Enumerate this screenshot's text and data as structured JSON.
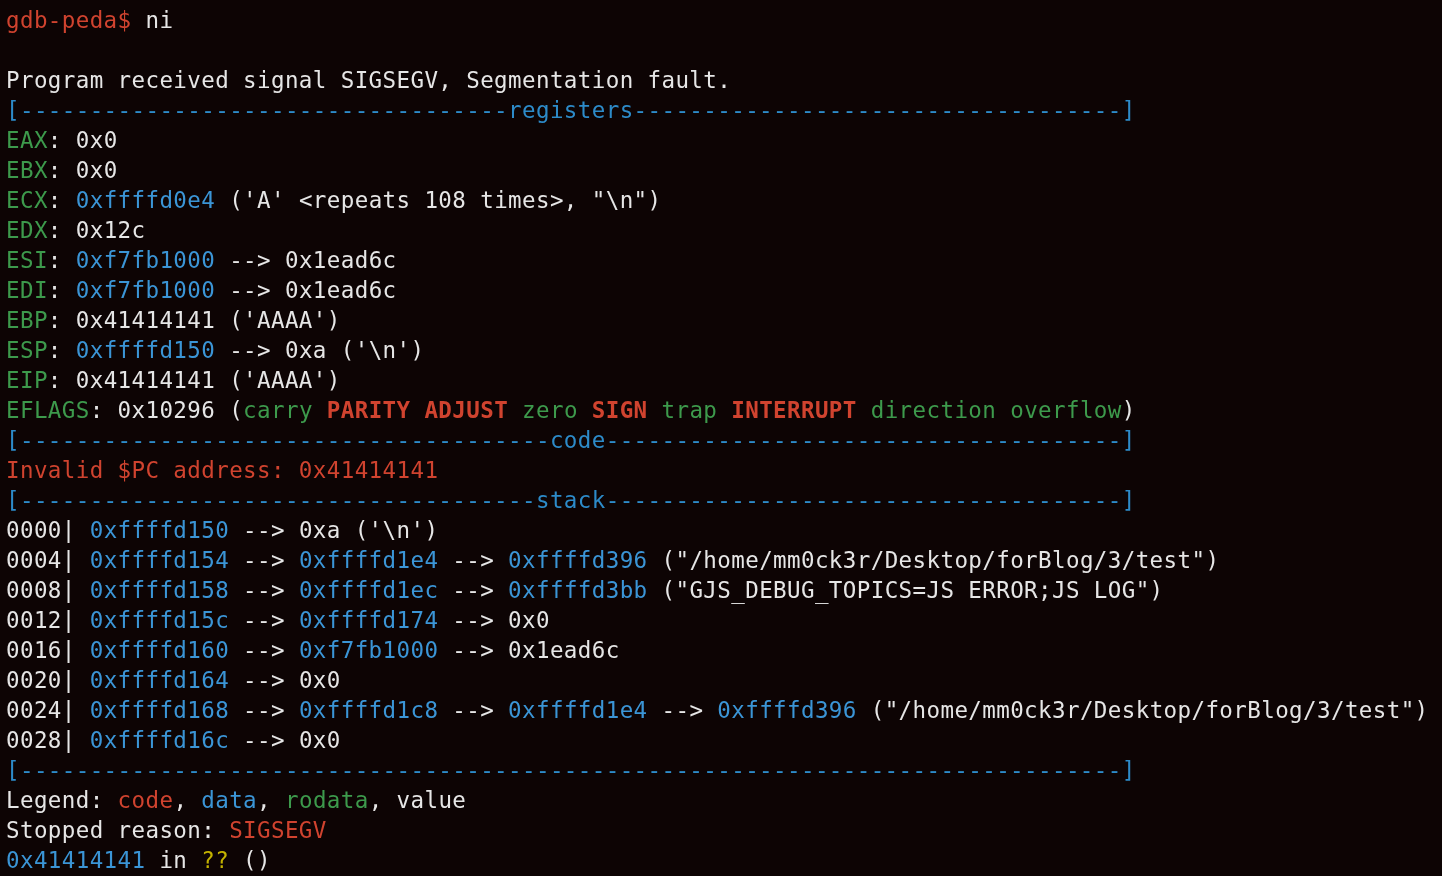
{
  "terminal": {
    "lines": [
      {
        "kind": "text",
        "segments": [
          {
            "text": "gdb-peda$ ",
            "kind": "code"
          },
          {
            "text": "ni",
            "kind": "plain"
          }
        ]
      },
      {
        "kind": "blank"
      },
      {
        "kind": "text",
        "segments": [
          {
            "text": "Program received signal SIGSEGV, Segmentation fault.",
            "kind": "plain"
          }
        ]
      },
      {
        "kind": "text",
        "segments": [
          {
            "text": "[-----------------------------------registers-----------------------------------]",
            "kind": "rule"
          }
        ]
      },
      {
        "kind": "text",
        "segments": [
          {
            "text": "EAX",
            "kind": "rodata"
          },
          {
            "text": ": 0x0",
            "kind": "plain"
          }
        ]
      },
      {
        "kind": "text",
        "segments": [
          {
            "text": "EBX",
            "kind": "rodata"
          },
          {
            "text": ": 0x0",
            "kind": "plain"
          }
        ]
      },
      {
        "kind": "text",
        "segments": [
          {
            "text": "ECX",
            "kind": "rodata"
          },
          {
            "text": ": ",
            "kind": "plain"
          },
          {
            "text": "0xffffd0e4",
            "kind": "data"
          },
          {
            "text": " ('A' <repeats 108 times>, \"\\n\")",
            "kind": "plain"
          }
        ]
      },
      {
        "kind": "text",
        "segments": [
          {
            "text": "EDX",
            "kind": "rodata"
          },
          {
            "text": ": 0x12c",
            "kind": "plain"
          }
        ]
      },
      {
        "kind": "text",
        "segments": [
          {
            "text": "ESI",
            "kind": "rodata"
          },
          {
            "text": ": ",
            "kind": "plain"
          },
          {
            "text": "0xf7fb1000",
            "kind": "data"
          },
          {
            "text": " --> 0x1ead6c",
            "kind": "plain"
          }
        ]
      },
      {
        "kind": "text",
        "segments": [
          {
            "text": "EDI",
            "kind": "rodata"
          },
          {
            "text": ": ",
            "kind": "plain"
          },
          {
            "text": "0xf7fb1000",
            "kind": "data"
          },
          {
            "text": " --> 0x1ead6c",
            "kind": "plain"
          }
        ]
      },
      {
        "kind": "text",
        "segments": [
          {
            "text": "EBP",
            "kind": "rodata"
          },
          {
            "text": ": 0x41414141 ('AAAA')",
            "kind": "plain"
          }
        ]
      },
      {
        "kind": "text",
        "segments": [
          {
            "text": "ESP",
            "kind": "rodata"
          },
          {
            "text": ": ",
            "kind": "plain"
          },
          {
            "text": "0xffffd150",
            "kind": "data"
          },
          {
            "text": " --> 0xa ('\\n')",
            "kind": "plain"
          }
        ]
      },
      {
        "kind": "text",
        "segments": [
          {
            "text": "EIP",
            "kind": "rodata"
          },
          {
            "text": ": 0x41414141 ('AAAA')",
            "kind": "plain"
          }
        ]
      },
      {
        "kind": "text",
        "segments": [
          {
            "text": "EFLAGS",
            "kind": "rodata"
          },
          {
            "text": ": 0x10296 (",
            "kind": "plain"
          },
          {
            "text": "carry ",
            "kind": "rodata"
          },
          {
            "text": "PARITY ADJUST ",
            "kind": "flag"
          },
          {
            "text": "zero ",
            "kind": "rodata"
          },
          {
            "text": "SIGN ",
            "kind": "flag"
          },
          {
            "text": "trap ",
            "kind": "rodata"
          },
          {
            "text": "INTERRUPT ",
            "kind": "flag"
          },
          {
            "text": "direction overflow",
            "kind": "rodata"
          },
          {
            "text": ")",
            "kind": "plain"
          }
        ]
      },
      {
        "kind": "text",
        "segments": [
          {
            "text": "[--------------------------------------code-------------------------------------]",
            "kind": "rule"
          }
        ]
      },
      {
        "kind": "text",
        "segments": [
          {
            "text": "Invalid $PC address: 0x41414141",
            "kind": "code"
          }
        ]
      },
      {
        "kind": "text",
        "segments": [
          {
            "text": "[-------------------------------------stack-------------------------------------]",
            "kind": "rule"
          }
        ]
      },
      {
        "kind": "text",
        "segments": [
          {
            "text": "0000| ",
            "kind": "plain"
          },
          {
            "text": "0xffffd150",
            "kind": "data"
          },
          {
            "text": " --> 0xa ('\\n')",
            "kind": "plain"
          }
        ]
      },
      {
        "kind": "text",
        "segments": [
          {
            "text": "0004| ",
            "kind": "plain"
          },
          {
            "text": "0xffffd154",
            "kind": "data"
          },
          {
            "text": " --> ",
            "kind": "plain"
          },
          {
            "text": "0xffffd1e4",
            "kind": "data"
          },
          {
            "text": " --> ",
            "kind": "plain"
          },
          {
            "text": "0xffffd396",
            "kind": "data"
          },
          {
            "text": " (\"/home/mm0ck3r/Desktop/forBlog/3/test\")",
            "kind": "plain"
          }
        ]
      },
      {
        "kind": "text",
        "segments": [
          {
            "text": "0008| ",
            "kind": "plain"
          },
          {
            "text": "0xffffd158",
            "kind": "data"
          },
          {
            "text": " --> ",
            "kind": "plain"
          },
          {
            "text": "0xffffd1ec",
            "kind": "data"
          },
          {
            "text": " --> ",
            "kind": "plain"
          },
          {
            "text": "0xffffd3bb",
            "kind": "data"
          },
          {
            "text": " (\"GJS_DEBUG_TOPICS=JS ERROR;JS LOG\")",
            "kind": "plain"
          }
        ]
      },
      {
        "kind": "text",
        "segments": [
          {
            "text": "0012| ",
            "kind": "plain"
          },
          {
            "text": "0xffffd15c",
            "kind": "data"
          },
          {
            "text": " --> ",
            "kind": "plain"
          },
          {
            "text": "0xffffd174",
            "kind": "data"
          },
          {
            "text": " --> 0x0",
            "kind": "plain"
          }
        ]
      },
      {
        "kind": "text",
        "segments": [
          {
            "text": "0016| ",
            "kind": "plain"
          },
          {
            "text": "0xffffd160",
            "kind": "data"
          },
          {
            "text": " --> ",
            "kind": "plain"
          },
          {
            "text": "0xf7fb1000",
            "kind": "data"
          },
          {
            "text": " --> 0x1ead6c",
            "kind": "plain"
          }
        ]
      },
      {
        "kind": "text",
        "segments": [
          {
            "text": "0020| ",
            "kind": "plain"
          },
          {
            "text": "0xffffd164",
            "kind": "data"
          },
          {
            "text": " --> 0x0",
            "kind": "plain"
          }
        ]
      },
      {
        "kind": "text",
        "segments": [
          {
            "text": "0024| ",
            "kind": "plain"
          },
          {
            "text": "0xffffd168",
            "kind": "data"
          },
          {
            "text": " --> ",
            "kind": "plain"
          },
          {
            "text": "0xffffd1c8",
            "kind": "data"
          },
          {
            "text": " --> ",
            "kind": "plain"
          },
          {
            "text": "0xffffd1e4",
            "kind": "data"
          },
          {
            "text": " --> ",
            "kind": "plain"
          },
          {
            "text": "0xffffd396",
            "kind": "data"
          },
          {
            "text": " (\"/home/mm0ck3r/Desktop/forBlog/3/test\")",
            "kind": "plain"
          }
        ]
      },
      {
        "kind": "text",
        "segments": [
          {
            "text": "0028| ",
            "kind": "plain"
          },
          {
            "text": "0xffffd16c",
            "kind": "data"
          },
          {
            "text": " --> 0x0",
            "kind": "plain"
          }
        ]
      },
      {
        "kind": "text",
        "segments": [
          {
            "text": "[-------------------------------------------------------------------------------]",
            "kind": "rule"
          }
        ]
      },
      {
        "kind": "text",
        "segments": [
          {
            "text": "Legend: ",
            "kind": "plain"
          },
          {
            "text": "code",
            "kind": "code"
          },
          {
            "text": ", ",
            "kind": "plain"
          },
          {
            "text": "data",
            "kind": "data"
          },
          {
            "text": ", ",
            "kind": "plain"
          },
          {
            "text": "rodata",
            "kind": "rodata"
          },
          {
            "text": ", value",
            "kind": "plain"
          }
        ]
      },
      {
        "kind": "text",
        "segments": [
          {
            "text": "Stopped reason: ",
            "kind": "plain"
          },
          {
            "text": "SIGSEGV",
            "kind": "code"
          }
        ]
      },
      {
        "kind": "text",
        "segments": [
          {
            "text": "0x41414141",
            "kind": "data"
          },
          {
            "text": " in ",
            "kind": "plain"
          },
          {
            "text": "??",
            "kind": "unknown"
          },
          {
            "text": " ()",
            "kind": "plain"
          }
        ]
      }
    ]
  }
}
